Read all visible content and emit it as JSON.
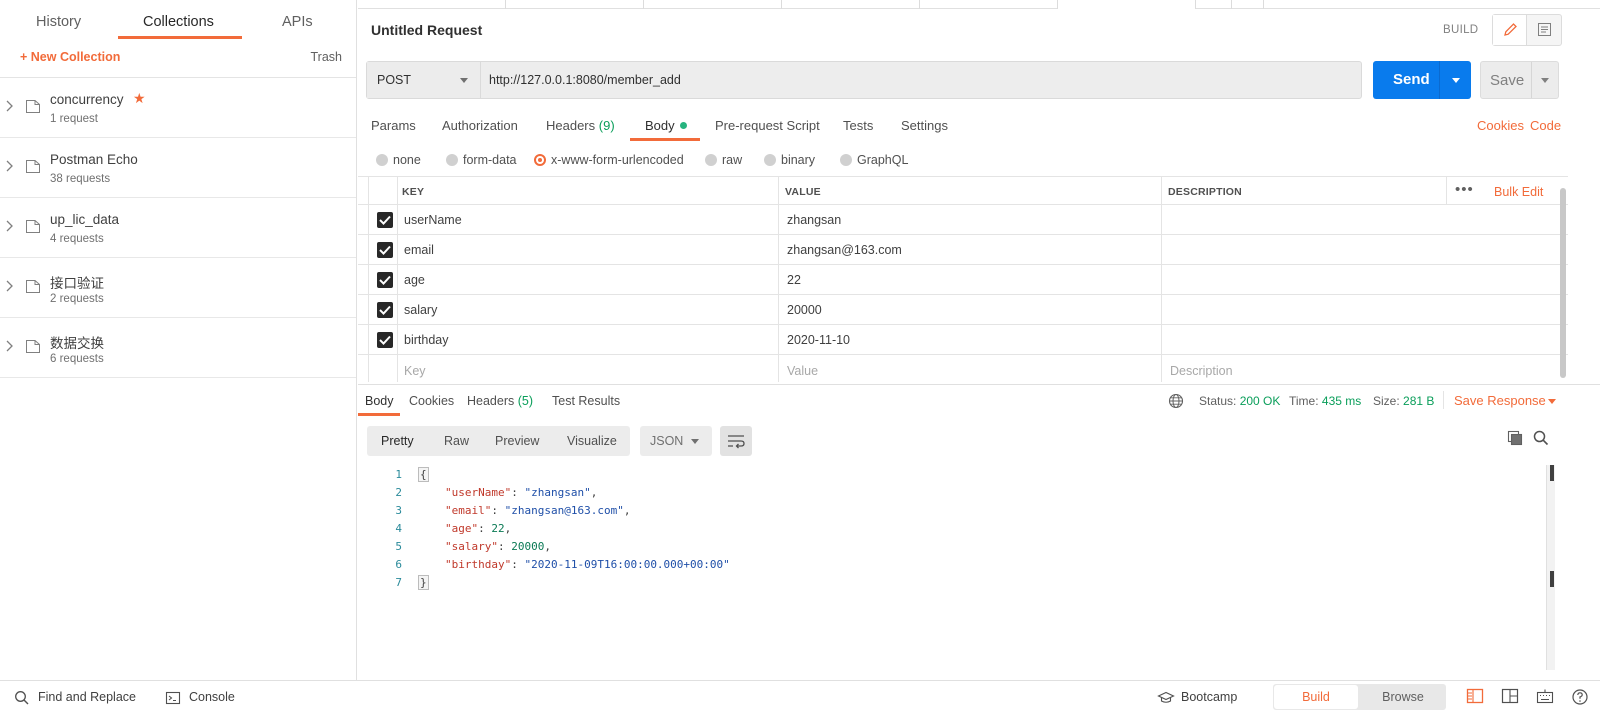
{
  "sidebar": {
    "tabs": [
      {
        "label": "History"
      },
      {
        "label": "Collections"
      },
      {
        "label": "APIs"
      }
    ],
    "new_collection": "+ New Collection",
    "trash": "Trash",
    "collections": [
      {
        "name": "concurrency",
        "count": "1 request",
        "starred": true
      },
      {
        "name": "Postman Echo",
        "count": "38 requests"
      },
      {
        "name": "up_lic_data",
        "count": "4 requests"
      },
      {
        "name": "接口验证",
        "count": "2 requests"
      },
      {
        "name": "数据交换",
        "count": "6 requests"
      }
    ]
  },
  "request": {
    "title": "Untitled Request",
    "mode_label": "BUILD",
    "method": "POST",
    "url": "http://127.0.0.1:8080/member_add",
    "send": "Send",
    "save": "Save",
    "tabs": {
      "params": "Params",
      "authorization": "Authorization",
      "headers": "Headers",
      "headers_count": "(9)",
      "body": "Body",
      "prerequest": "Pre-request Script",
      "tests": "Tests",
      "settings": "Settings"
    },
    "cookies": "Cookies",
    "code": "Code",
    "body_types": [
      "none",
      "form-data",
      "x-www-form-urlencoded",
      "raw",
      "binary",
      "GraphQL"
    ],
    "body_type_selected": "x-www-form-urlencoded",
    "columns": {
      "key": "KEY",
      "value": "VALUE",
      "description": "DESCRIPTION"
    },
    "bulk_edit": "Bulk Edit",
    "rows": [
      {
        "key": "userName",
        "value": "zhangsan",
        "checked": true
      },
      {
        "key": "email",
        "value": "zhangsan@163.com",
        "checked": true
      },
      {
        "key": "age",
        "value": "22",
        "checked": true
      },
      {
        "key": "salary",
        "value": "20000",
        "checked": true
      },
      {
        "key": "birthday",
        "value": "2020-11-10",
        "checked": true
      }
    ],
    "placeholders": {
      "key": "Key",
      "value": "Value",
      "description": "Description"
    }
  },
  "response": {
    "tabs": {
      "body": "Body",
      "cookies": "Cookies",
      "headers": "Headers",
      "headers_count": "(5)",
      "test_results": "Test Results"
    },
    "status_label": "Status:",
    "status": "200 OK",
    "time_label": "Time:",
    "time": "435 ms",
    "size_label": "Size:",
    "size": "281 B",
    "save_response": "Save Response",
    "views": [
      "Pretty",
      "Raw",
      "Preview",
      "Visualize"
    ],
    "view_selected": "Pretty",
    "format": "JSON",
    "body_lines": [
      {
        "n": "1",
        "type": "open",
        "text": "{"
      },
      {
        "n": "2",
        "type": "kv",
        "key": "\"userName\"",
        "value": "\"zhangsan\"",
        "vtype": "s",
        "comma": ","
      },
      {
        "n": "3",
        "type": "kv",
        "key": "\"email\"",
        "value": "\"zhangsan@163.com\"",
        "vtype": "s",
        "comma": ","
      },
      {
        "n": "4",
        "type": "kv",
        "key": "\"age\"",
        "value": "22",
        "vtype": "n",
        "comma": ","
      },
      {
        "n": "5",
        "type": "kv",
        "key": "\"salary\"",
        "value": "20000",
        "vtype": "n",
        "comma": ","
      },
      {
        "n": "6",
        "type": "kv",
        "key": "\"birthday\"",
        "value": "\"2020-11-09T16:00:00.000+00:00\"",
        "vtype": "s",
        "comma": ""
      },
      {
        "n": "7",
        "type": "close",
        "text": "}"
      }
    ]
  },
  "statusbar": {
    "find_replace": "Find and Replace",
    "console": "Console",
    "bootcamp": "Bootcamp",
    "build": "Build",
    "browse": "Browse"
  },
  "colors": {
    "accent": "#f26b3a",
    "send_blue": "#097bed",
    "status_green": "#0a9e5a"
  }
}
